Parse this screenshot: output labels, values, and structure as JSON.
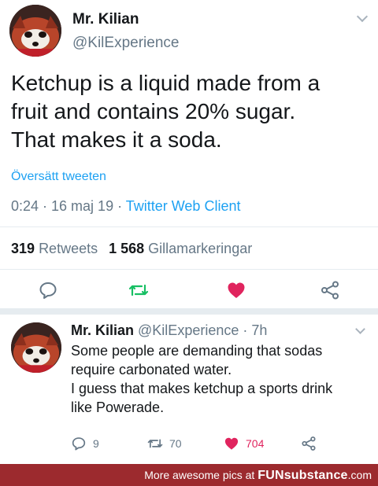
{
  "main_tweet": {
    "author_name": "Mr. Kilian",
    "author_handle": "@KilExperience",
    "text_lines": [
      "Ketchup is a liquid made from a",
      "fruit and contains 20% sugar.",
      "That makes it a soda."
    ],
    "translate_label": "Översätt tweeten",
    "timestamp": "0:24 · 16 maj 19 · ",
    "source": "Twitter Web Client",
    "retweets_count": "319",
    "retweets_label": "Retweets",
    "likes_count": "1 568",
    "likes_label": "Gillamarkeringar",
    "icons": {
      "reply": "reply-icon",
      "retweet": "retweet-icon",
      "like": "heart-icon",
      "share": "share-icon",
      "menu": "chevron-down-icon"
    }
  },
  "reply_tweet": {
    "author_name": "Mr. Kilian",
    "author_handle": "@KilExperience · 7h",
    "text_lines": [
      "Some people are demanding that sodas",
      "require carbonated water.",
      "I guess that makes ketchup a sports drink",
      "like Powerade."
    ],
    "reply_count": "9",
    "retweet_count": "70",
    "like_count": "704"
  },
  "footer": {
    "prefix": "More awesome pics at ",
    "brand": "FUNsubstance",
    "suffix": ".com"
  },
  "colors": {
    "accent": "#1da1f2",
    "retweet_green": "#17bf63",
    "like_red": "#e0245e",
    "muted": "#657786",
    "footer_bg": "#9c2a2e"
  }
}
